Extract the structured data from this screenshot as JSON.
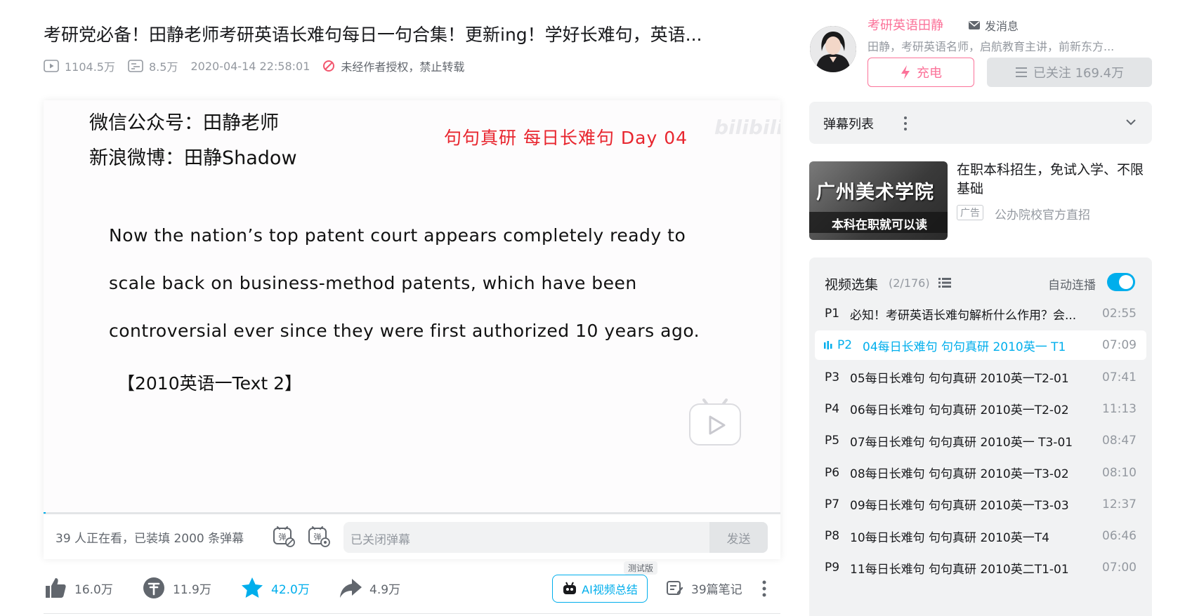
{
  "video": {
    "title": "考研党必备！田静老师考研英语长难句每日一句合集！更新ing！学好长难句，英语...",
    "views": "1104.5万",
    "danmaku_count": "8.5万",
    "publish_time": "2020-04-14 22:58:01",
    "copyright_notice": "未经作者授权，禁止转载"
  },
  "frame": {
    "wechat": "微信公众号：田静老师",
    "weibo": "新浪微博：田静Shadow",
    "red_title": "句句真研 每日长难句 Day 04",
    "watermark": "bilibili",
    "sentence_lines": [
      "Now the nation’s top patent court appears completely ready to",
      "scale back on business-method patents, which have been",
      "controversial ever since they were first authorized 10 years ago."
    ],
    "source": "【2010英语一Text 2】",
    "progress_fraction": 0.003
  },
  "danmaku_bar": {
    "viewers": "39 人正在看，已装填 2000 条弹幕",
    "input_placeholder": "已关闭弹幕",
    "send_label": "发送"
  },
  "toolbar": {
    "like_count": "16.0万",
    "coin_count": "11.9万",
    "favorite_count": "42.0万",
    "share_count": "4.9万",
    "ai_summary_label": "AI视频总结",
    "beta_tag": "测试版",
    "notes_label": "39篇笔记"
  },
  "uploader": {
    "name": "考研英语田静",
    "message_label": "发消息",
    "description": "田静，考研英语名师，启航教育主讲，前新东方...",
    "charge_label": "充电",
    "follow_label": "已关注 169.4万"
  },
  "danmaku_list": {
    "title": "弹幕列表"
  },
  "ad": {
    "image_title": "广州美术学院",
    "image_subtitle": "本科在职就可以读",
    "text": "在职本科招生，免试入学、不限基础",
    "badge": "广告",
    "source": "公办院校官方直招"
  },
  "playlist": {
    "title": "视频选集",
    "count": "(2/176)",
    "autoplay_label": "自动连播",
    "autoplay_on": true,
    "episodes": [
      {
        "num": "P1",
        "title": "必知！考研英语长难句解析什么作用？会...",
        "duration": "02:55"
      },
      {
        "num": "P2",
        "title": "04每日长难句 句句真研 2010英一 T1",
        "duration": "07:09"
      },
      {
        "num": "P3",
        "title": "05每日长难句 句句真研 2010英一T2-01",
        "duration": "07:41"
      },
      {
        "num": "P4",
        "title": "06每日长难句 句句真研 2010英一T2-02",
        "duration": "11:13"
      },
      {
        "num": "P5",
        "title": "07每日长难句 句句真研 2010英一 T3-01",
        "duration": "08:47"
      },
      {
        "num": "P6",
        "title": "08每日长难句 句句真研 2010英一T3-02",
        "duration": "08:10"
      },
      {
        "num": "P7",
        "title": "09每日长难句 句句真研 2010英一T3-03",
        "duration": "12:37"
      },
      {
        "num": "P8",
        "title": "10每日长难句 句句真研 2010英一T4",
        "duration": "06:46"
      },
      {
        "num": "P9",
        "title": "11每日长难句 句句真研 2010英二T1-01",
        "duration": "07:00"
      }
    ]
  },
  "colors": {
    "accent": "#00aeec",
    "brand_pink": "#fb7299",
    "frame_red": "#e8262f"
  }
}
